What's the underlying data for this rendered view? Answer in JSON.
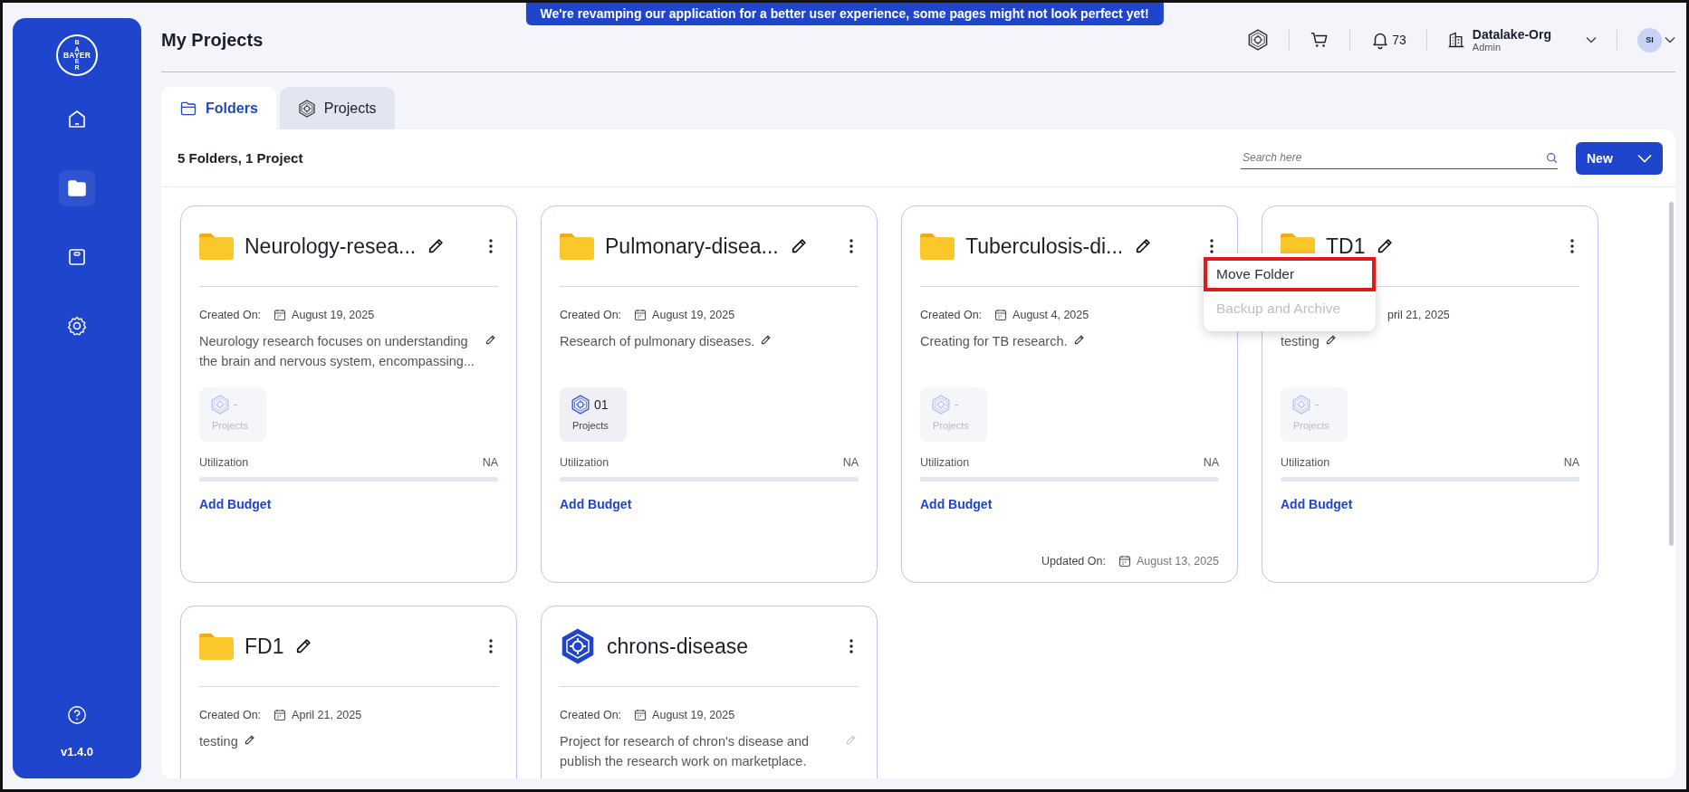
{
  "banner": "We're revamping our application for a better user experience, some pages might not look perfect yet!",
  "sidebar": {
    "logo": {
      "vertical_top": "BA",
      "horizontal": "BAYER",
      "vertical_bottom": "ER"
    },
    "items": [
      {
        "selected": false
      },
      {
        "selected": true
      },
      {
        "selected": false
      },
      {
        "selected": false
      }
    ],
    "version": "v1.4.0"
  },
  "header": {
    "title": "My Projects",
    "notifications": "73",
    "org": {
      "name": "Datalake-Org",
      "role": "Admin"
    },
    "avatar": "SI"
  },
  "tabs": [
    {
      "label": "Folders",
      "selected": true
    },
    {
      "label": "Projects",
      "selected": false
    }
  ],
  "panel": {
    "summary": "5 Folders, 1 Project",
    "search": {
      "placeholder": "Search here"
    },
    "new_button": "New",
    "cards": [
      {
        "kind": "folder",
        "title": "Neurology-resea...",
        "created": {
          "label": "Created On:",
          "date": "August 19, 2025"
        },
        "description": "Neurology research focuses on understanding the brain and nervous system, encompassing...",
        "projects": {
          "count": "-",
          "label": "Projects",
          "enabled": false
        },
        "utilization": {
          "label": "Utilization",
          "value": "NA",
          "level": 0
        },
        "budget": "Add Budget"
      },
      {
        "kind": "folder",
        "title": "Pulmonary-disea...",
        "created": {
          "label": "Created On:",
          "date": "August 19, 2025"
        },
        "description": "Research of pulmonary diseases.",
        "projects": {
          "count": "01",
          "label": "Projects",
          "enabled": true
        },
        "utilization": {
          "label": "Utilization",
          "value": "NA",
          "level": 0
        },
        "budget": "Add Budget"
      },
      {
        "kind": "folder",
        "title": "Tuberculosis-di...",
        "created": {
          "label": "Created On:",
          "date": "August 4, 2025"
        },
        "description": "Creating for TB research.",
        "projects": {
          "count": "-",
          "label": "Projects",
          "enabled": false
        },
        "utilization": {
          "label": "Utilization",
          "value": "NA",
          "level": 0
        },
        "budget": "Add Budget",
        "updated": {
          "label": "Updated On:",
          "date": "August 13, 2025"
        },
        "menu": [
          {
            "label": "Move Folder",
            "disabled": false,
            "highlighted": true
          },
          {
            "label": "Backup and Archive",
            "disabled": true,
            "highlighted": false
          }
        ]
      },
      {
        "kind": "folder",
        "title": "TD1",
        "created": {
          "date": "pril 21, 2025"
        },
        "description": "testing",
        "projects": {
          "count": "-",
          "label": "Projects",
          "enabled": false
        },
        "utilization": {
          "label": "Utilization",
          "value": "NA",
          "level": 0
        },
        "budget": "Add Budget"
      },
      {
        "kind": "folder",
        "title": "FD1",
        "created": {
          "label": "Created On:",
          "date": "April 21, 2025"
        },
        "description": "testing"
      },
      {
        "kind": "project",
        "title": "chrons-disease",
        "created": {
          "label": "Created On:",
          "date": "August 19, 2025"
        },
        "description": "Project for research of chron's disease and publish the research work on marketplace."
      }
    ]
  }
}
